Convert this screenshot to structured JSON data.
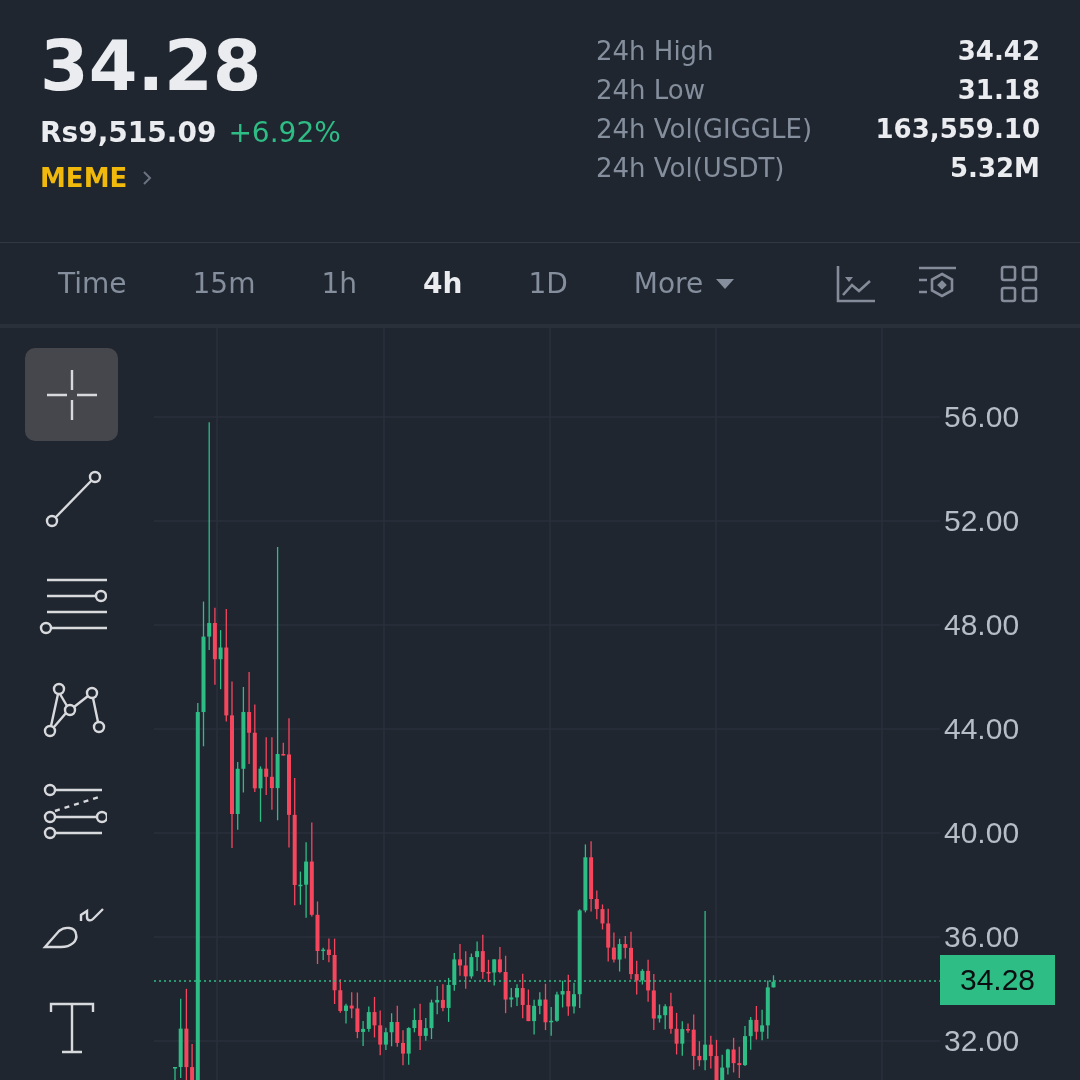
{
  "ticker": {
    "price": "34.28",
    "fiat_price": "Rs9,515.09",
    "change": "+6.92%",
    "tag": "MEME"
  },
  "stats": [
    {
      "label": "24h High",
      "value": "34.42"
    },
    {
      "label": "24h Low",
      "value": "31.18"
    },
    {
      "label": "24h Vol(GIGGLE)",
      "value": "163,559.10"
    },
    {
      "label": "24h Vol(USDT)",
      "value": "5.32M"
    }
  ],
  "intervals": [
    {
      "label": "Time",
      "selected": false,
      "kind": "tab"
    },
    {
      "label": "15m",
      "selected": false,
      "kind": "tab"
    },
    {
      "label": "1h",
      "selected": false,
      "kind": "tab"
    },
    {
      "label": "4h",
      "selected": true,
      "kind": "tab"
    },
    {
      "label": "1D",
      "selected": false,
      "kind": "tab"
    },
    {
      "label": "More",
      "selected": false,
      "kind": "dropdown"
    }
  ],
  "drawing_tools": [
    {
      "kind": "crosshair",
      "selected": true
    },
    {
      "kind": "trend-line",
      "selected": false
    },
    {
      "kind": "parallel-lines",
      "selected": false
    },
    {
      "kind": "pattern",
      "selected": false
    },
    {
      "kind": "fibonacci",
      "selected": false
    },
    {
      "kind": "brush",
      "selected": false
    },
    {
      "kind": "text",
      "selected": false
    }
  ],
  "chart": {
    "y_axis_labels": [
      "56.00",
      "52.00",
      "48.00",
      "44.00",
      "40.00",
      "36.00",
      "32.00"
    ],
    "last_price": "34.28"
  }
}
